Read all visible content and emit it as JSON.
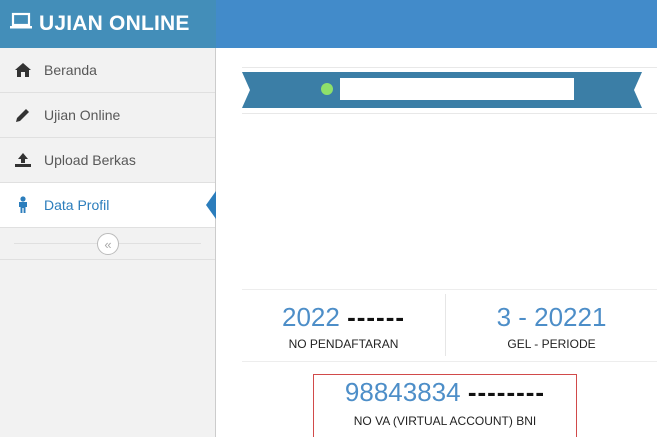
{
  "app": {
    "title": "UJIAN ONLINE",
    "icon": "laptop-icon"
  },
  "sidebar": {
    "items": [
      {
        "label": "Beranda",
        "icon": "home-icon",
        "active": false
      },
      {
        "label": "Ujian Online",
        "icon": "pencil-icon",
        "active": false
      },
      {
        "label": "Upload Berkas",
        "icon": "upload-icon",
        "active": false
      },
      {
        "label": "Data Profil",
        "icon": "user-icon",
        "active": true
      }
    ],
    "collapse_icon": "«"
  },
  "colors": {
    "topbar": "#438eb9",
    "accent": "#2b7dbc",
    "ribbon": "#3b7ea6",
    "dot": "#8ee06a",
    "va_border": "#d14a4a"
  },
  "stats": {
    "registration": {
      "value": "2022",
      "masked": "------",
      "label": "NO PENDAFTARAN"
    },
    "period": {
      "value": "3 - 20221",
      "label": "GEL - PERIODE"
    },
    "va": {
      "value": "98843834",
      "masked": "--------",
      "label": "NO VA (VIRTUAL ACCOUNT) BNI"
    }
  }
}
